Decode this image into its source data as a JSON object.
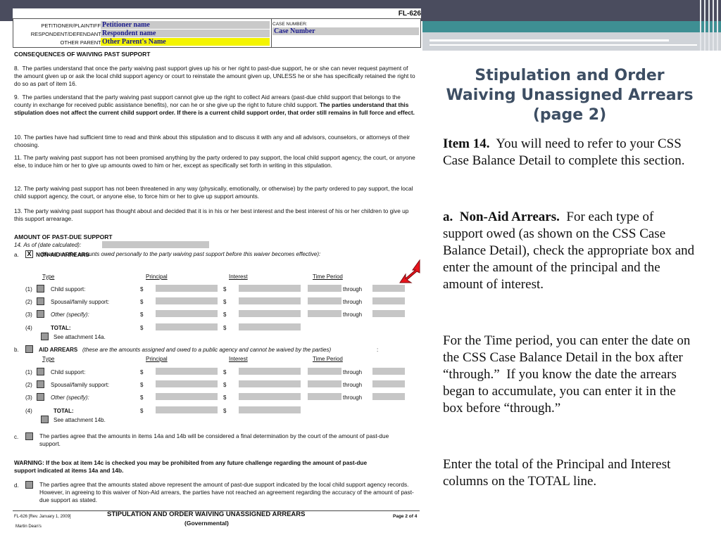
{
  "form": {
    "form_id": "FL-626",
    "header": {
      "petitioner_label": "PETITIONER/PLAINTIFF:",
      "petitioner_value": "Petitioner name",
      "respondent_label": "RESPONDENT/DEFENDANT:",
      "respondent_value": "Respondent name",
      "other_label": "OTHER PARENT:",
      "other_value": "Other Parent's Name",
      "case_label": "CASE NUMBER:",
      "case_value": "Case Number"
    },
    "section1_title": "CONSEQUENCES OF WAIVING PAST SUPPORT",
    "p8": "8.  The parties understand that once the party waiving past support gives up his or her right to past-due support, he or she can never request payment of the amount given up or ask the local child support agency or court to reinstate the amount given up, UNLESS he or she has specifically retained the right to do so as part of item 16.",
    "p9a": "9.  The parties understand that the party waiving past support cannot give up the right to collect Aid arrears (past-due child support that belongs to the county in exchange for received public assistance benefits), nor can he or she give up the right to future child support. ",
    "p9b": "The parties understand that this stipulation does not affect the current child support order. If there is a current child support order, that order still remains in full force and effect.",
    "p10": "10. The parties have had sufficient time to read and think about this stipulation and to discuss it with any and all advisors, counselors, or attorneys of their choosing.",
    "p11": "11. The party waiving past support has not been promised anything by the party ordered to pay support, the local child support agency, the court, or anyone else, to induce him or her to give up amounts owed to him or her, except as specifically set forth in writing in this stipulation.",
    "p12": "12. The party waiving past support has not been threatened in any way (physically, emotionally, or otherwise) by the party ordered to pay support, the local child support agency, the court, or anyone else, to force him or her to give up support amounts.",
    "p13": "13. The party waiving past support has thought about and decided that it is in his or her best interest and the best interest of his or her children to give up this support arrearage.",
    "section2_title": "AMOUNT OF PAST-DUE SUPPORT",
    "item14": "14. As of (date calculated):",
    "item_a_label": "a.",
    "non_aid_title": "NON-AID ARREARS",
    "non_aid_note": "(these are the amounts owed personally to the party waiving past support before this waiver becomes effective):",
    "col_type": "Type",
    "col_principal": "Principal",
    "col_interest": "Interest",
    "col_time": "Time Period",
    "row1_num": "(1)",
    "row2_num": "(2)",
    "row3_num": "(3)",
    "row4_num": "(4)",
    "a_row1": "Child support:",
    "a_row2": "Spousal/family support:",
    "a_row3": "Other (specify):",
    "total": "TOTAL:",
    "see_14a": "See attachment 14a.",
    "dollar": "$",
    "through": "through",
    "item_b_label": "b.",
    "aid_title": "AID ARREARS",
    "aid_note": "(these are the amounts assigned and owed to a public agency and cannot be waived by the parties)",
    "aid_colon": ":",
    "b_row1": "Child support:",
    "b_row2": "Spousal/family support:",
    "b_row3": "Other (specify):",
    "see_14b": "See attachment 14b.",
    "item_c_label": "c.",
    "item_c": "The parties agree that the amounts in items 14a and 14b will be considered a final determination by the court of the amount of past-due support.",
    "warning": "WARNING: If the box at item 14c is checked you may be prohibited from any future challenge regarding the amount of past-due support indicated at items 14a and 14b.",
    "item_d_label": "d.",
    "item_d": "The parties agree that the amounts stated above represent the amount of past-due support indicated by the local child support agency records. However, in agreeing to this waiver of Non-Aid arrears, the parties have not reached an agreement regarding the accuracy of the amount of past-due support as stated.",
    "footer_left": "FL-626 [Rev. January 1, 2009]",
    "footer_title": "STIPULATION AND ORDER WAIVING UNASSIGNED ARREARS",
    "footer_sub": "(Governmental)",
    "footer_page": "Page 2 of 4",
    "footer_publisher": "Martin Dean's"
  },
  "slide": {
    "title_line1": "Stipulation and Order",
    "title_line2": "Waiving Unassigned Arrears",
    "title_line3": "(page 2)",
    "p1_bold": "Item 14.",
    "p1_text": "  You will need to refer to your CSS Case Balance Detail to complete this section.",
    "p2_bold": "a.  Non-Aid Arrears.",
    "p2_text": "  For each type of support owed (as shown on the CSS Case Balance Detail), check the appropriate box and enter the amount of the principal and the amount of interest.",
    "p3": "For the Time period, you can enter the date on the CSS Case Balance Detail in the box after “through.”  If you know the date the arrears began to accumulate, you can enter it in the box before “through.”",
    "p4": "Enter the total of the Principal and Interest columns on the TOTAL line."
  },
  "colors": {
    "title": "#3d4e63",
    "top_band": "#4a4c5e",
    "teal_band": "#3e8f93",
    "arrow": "#e8141c"
  }
}
